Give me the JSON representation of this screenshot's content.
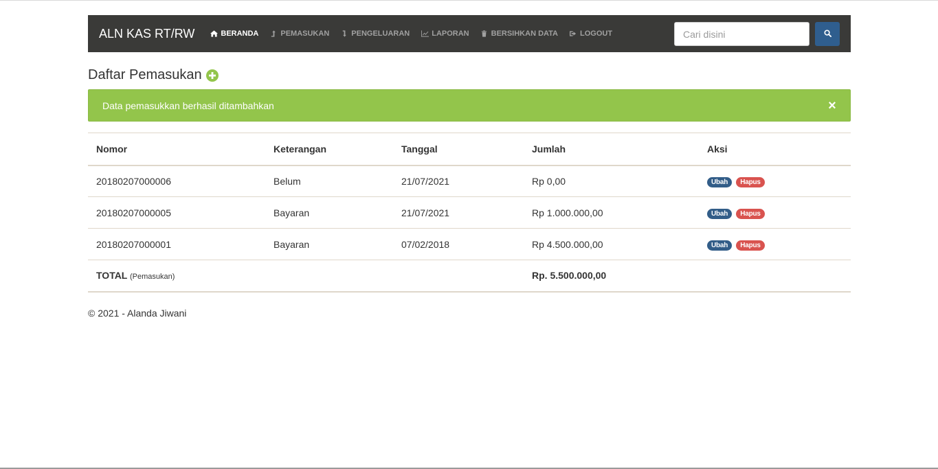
{
  "navbar": {
    "brand": "ALN KAS RT/RW",
    "items": [
      {
        "label": "BERANDA",
        "icon": "home-icon",
        "active": true
      },
      {
        "label": "PEMASUKAN",
        "icon": "arrow-up-icon",
        "active": false
      },
      {
        "label": "PENGELUARAN",
        "icon": "arrow-down-icon",
        "active": false
      },
      {
        "label": "LAPORAN",
        "icon": "line-chart-icon",
        "active": false
      },
      {
        "label": "BERSIHKAN DATA",
        "icon": "trash-icon",
        "active": false
      },
      {
        "label": "LOGOUT",
        "icon": "logout-icon",
        "active": false
      }
    ],
    "search": {
      "placeholder": "Cari disini",
      "value": "",
      "button_icon": "search-icon"
    }
  },
  "page": {
    "title": "Daftar Pemasukan",
    "add_icon": "plus-circle-icon"
  },
  "alert": {
    "message": "Data pemasukkan berhasil ditambahkan",
    "close": "×"
  },
  "table": {
    "headers": [
      "Nomor",
      "Keterangan",
      "Tanggal",
      "Jumlah",
      "Aksi"
    ],
    "rows": [
      {
        "nomor": "20180207000006",
        "keterangan": "Belum",
        "tanggal": "21/07/2021",
        "jumlah": "Rp 0,00"
      },
      {
        "nomor": "20180207000005",
        "keterangan": "Bayaran",
        "tanggal": "21/07/2021",
        "jumlah": "Rp 1.000.000,00"
      },
      {
        "nomor": "20180207000001",
        "keterangan": "Bayaran",
        "tanggal": "07/02/2018",
        "jumlah": "Rp 4.500.000,00"
      }
    ],
    "actions": {
      "edit": "Ubah",
      "delete": "Hapus"
    },
    "total": {
      "label": "TOTAL",
      "sub": "(Pemasukan)",
      "value": "Rp. 5.500.000,00"
    }
  },
  "footer": {
    "text": "© 2021 - Alanda Jiwani"
  },
  "colors": {
    "navbar_bg": "#3a3a38",
    "primary": "#325d88",
    "success": "#93c54b",
    "danger": "#d9534f"
  }
}
